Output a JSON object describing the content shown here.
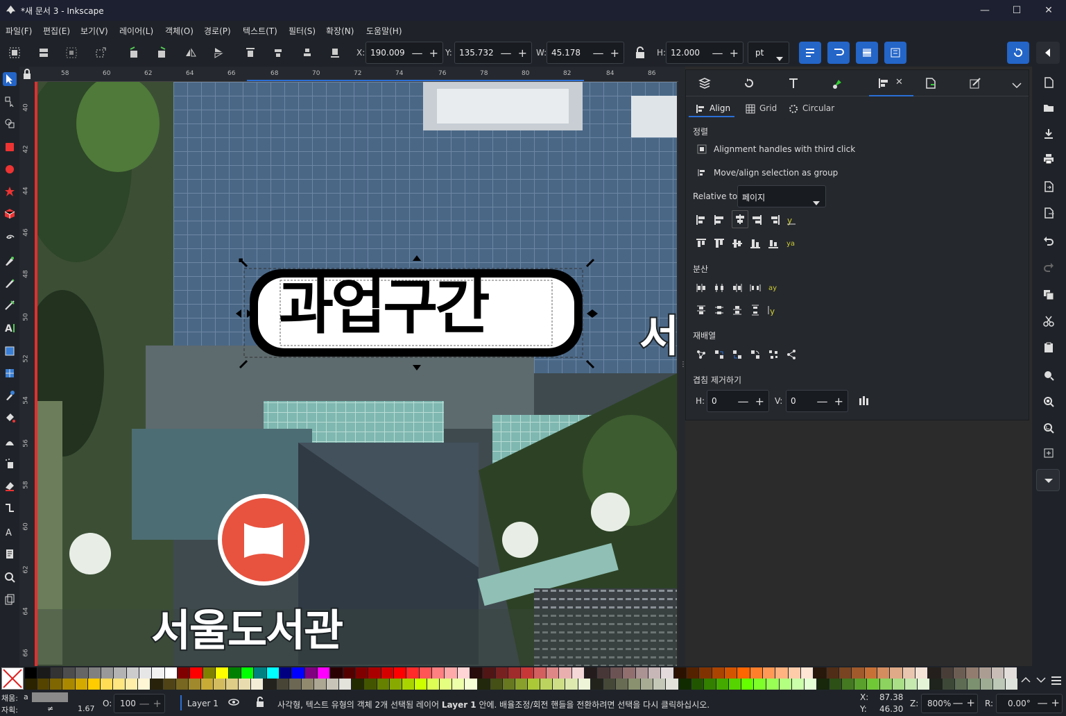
{
  "window": {
    "title": "*새 문서 3 - Inkscape",
    "minimize": "—",
    "maximize": "☐",
    "close": "✕"
  },
  "menu": [
    "파일(F)",
    "편집(E)",
    "보기(V)",
    "레이어(L)",
    "객체(O)",
    "경로(P)",
    "텍스트(T)",
    "필터(S)",
    "확장(N)",
    "도움말(H)"
  ],
  "coords": {
    "x_label": "X:",
    "x": "190.009",
    "y_label": "Y:",
    "y": "135.732",
    "w_label": "W:",
    "w": "45.178",
    "h_label": "H:",
    "h": "12.000",
    "unit": "pt",
    "pm": "— +"
  },
  "ruler": {
    "top": [
      "58",
      "60",
      "62",
      "64",
      "66",
      "68",
      "70",
      "72",
      "74",
      "76",
      "78",
      "80",
      "82",
      "84",
      "86"
    ],
    "left": [
      "40",
      "42",
      "44",
      "46",
      "48",
      "50",
      "52",
      "54",
      "56",
      "58",
      "60",
      "62",
      "64",
      "66"
    ]
  },
  "canvas": {
    "selected_text": "과업구간",
    "library_text": "서울도서관",
    "partial_text": "서"
  },
  "panel": {
    "tabs": [
      "Align",
      "Grid",
      "Circular"
    ],
    "section_align": "정렬",
    "opt_handles": "Alignment handles with third click",
    "opt_group": "Move/align selection as group",
    "relative_label": "Relative to:",
    "relative_value": "페이지",
    "section_distribute": "분산",
    "section_rearrange": "재배열",
    "section_overlap": "겹침 제거하기",
    "h_label": "H:",
    "h_value": "0",
    "v_label": "V:",
    "v_value": "0",
    "pm": "— +"
  },
  "status": {
    "fill_label": "채움:",
    "fill_value": "a",
    "stroke_label": "자획:",
    "stroke_value": "≠",
    "stroke_width": "1.67",
    "opacity_label": "O:",
    "opacity": "100",
    "layer": "Layer 1",
    "message_pre": "사각형, 텍스트 유형의 객체 2개 선택됨 레이어 ",
    "message_layer": "Layer 1",
    "message_post": " 안에. 배율조정/회전 핸들을 전환하려면 선택을 다시 클릭하십시오.",
    "x_label": "X:",
    "x": "87.38",
    "y_label": "Y:",
    "y": "46.30",
    "zoom_label": "Z:",
    "zoom": "800%",
    "rot_label": "R:",
    "rotation": "0.00°"
  },
  "colors": {
    "accent": "#2465c8",
    "chrome": "#1f2329",
    "panel": "#25282d",
    "red_icon": "#e8533f"
  },
  "palette_row1": [
    "#000000",
    "#1a1a1a",
    "#333333",
    "#4d4d4d",
    "#666666",
    "#808080",
    "#999999",
    "#b3b3b3",
    "#cccccc",
    "#e6e6e6",
    "#f2f2f2",
    "#ffffff",
    "#800000",
    "#ff0000",
    "#808000",
    "#ffff00",
    "#008000",
    "#00ff00",
    "#008080",
    "#00ffff",
    "#000080",
    "#0000ff",
    "#800080",
    "#ff00ff",
    "#2b0000",
    "#550000",
    "#800000",
    "#aa0000",
    "#d40000",
    "#ff0000",
    "#ff2a2a",
    "#ff5555",
    "#ff8080",
    "#ffaaaa",
    "#ffd5d5",
    "#280b0b",
    "#501616",
    "#782121",
    "#a02c2c",
    "#c83737",
    "#d35f5f",
    "#de8787",
    "#e9afaf",
    "#f4d7d7",
    "#241c1c",
    "#483737",
    "#6c5353",
    "#916f6f",
    "#ac9393",
    "#c8b7b7",
    "#e3dbdb",
    "#2b1100",
    "#552200",
    "#803300",
    "#aa4400",
    "#d45500",
    "#ff6600",
    "#ff7f2a",
    "#ff9955",
    "#ffb380",
    "#ffccaa",
    "#ffe6d5",
    "#28170b",
    "#502d16",
    "#784421",
    "#a05a2c",
    "#c87137",
    "#d38d5f",
    "#deaa87",
    "#e9c6af",
    "#f4e3d7",
    "#241f1c",
    "#483e37",
    "#6c5d53",
    "#917c6f",
    "#ac9d93",
    "#c8beb7",
    "#e3dedb"
  ],
  "palette_row2": [
    "#2b2200",
    "#554400",
    "#806600",
    "#aa8800",
    "#d4aa00",
    "#ffcc00",
    "#ffdd55",
    "#ffe680",
    "#ffeeaa",
    "#fff6d5",
    "#28220b",
    "#504416",
    "#786721",
    "#a0892c",
    "#c8ab37",
    "#d3bc5f",
    "#decd87",
    "#e9ddaf",
    "#f4eed7",
    "#24221c",
    "#484537",
    "#6c6753",
    "#918a6f",
    "#aca793",
    "#c8c4b7",
    "#e3e2db",
    "#222b00",
    "#445500",
    "#668000",
    "#88aa00",
    "#aad400",
    "#ccff00",
    "#ddff55",
    "#e5ff80",
    "#eeffaa",
    "#f6ffd5",
    "#22280b",
    "#445016",
    "#677821",
    "#89a02c",
    "#abc837",
    "#bcd35f",
    "#cdde87",
    "#dde9af",
    "#eef4d7",
    "#22241c",
    "#454837",
    "#676c53",
    "#8a916f",
    "#a7ac93",
    "#c4c8b7",
    "#e2e3db",
    "#112b00",
    "#225500",
    "#338000",
    "#44aa00",
    "#55d400",
    "#66ff00",
    "#7fff2a",
    "#99ff55",
    "#b3ff80",
    "#ccffaa",
    "#e5ffd5",
    "#17280b",
    "#2d5016",
    "#447821",
    "#5aa02c",
    "#71c837",
    "#8dd35f",
    "#aade87",
    "#c6e9af",
    "#e3f4d7",
    "#1f241c",
    "#3e4837",
    "#5d6c53",
    "#7c916f",
    "#9dac93",
    "#bec8b7",
    "#dee3db"
  ]
}
